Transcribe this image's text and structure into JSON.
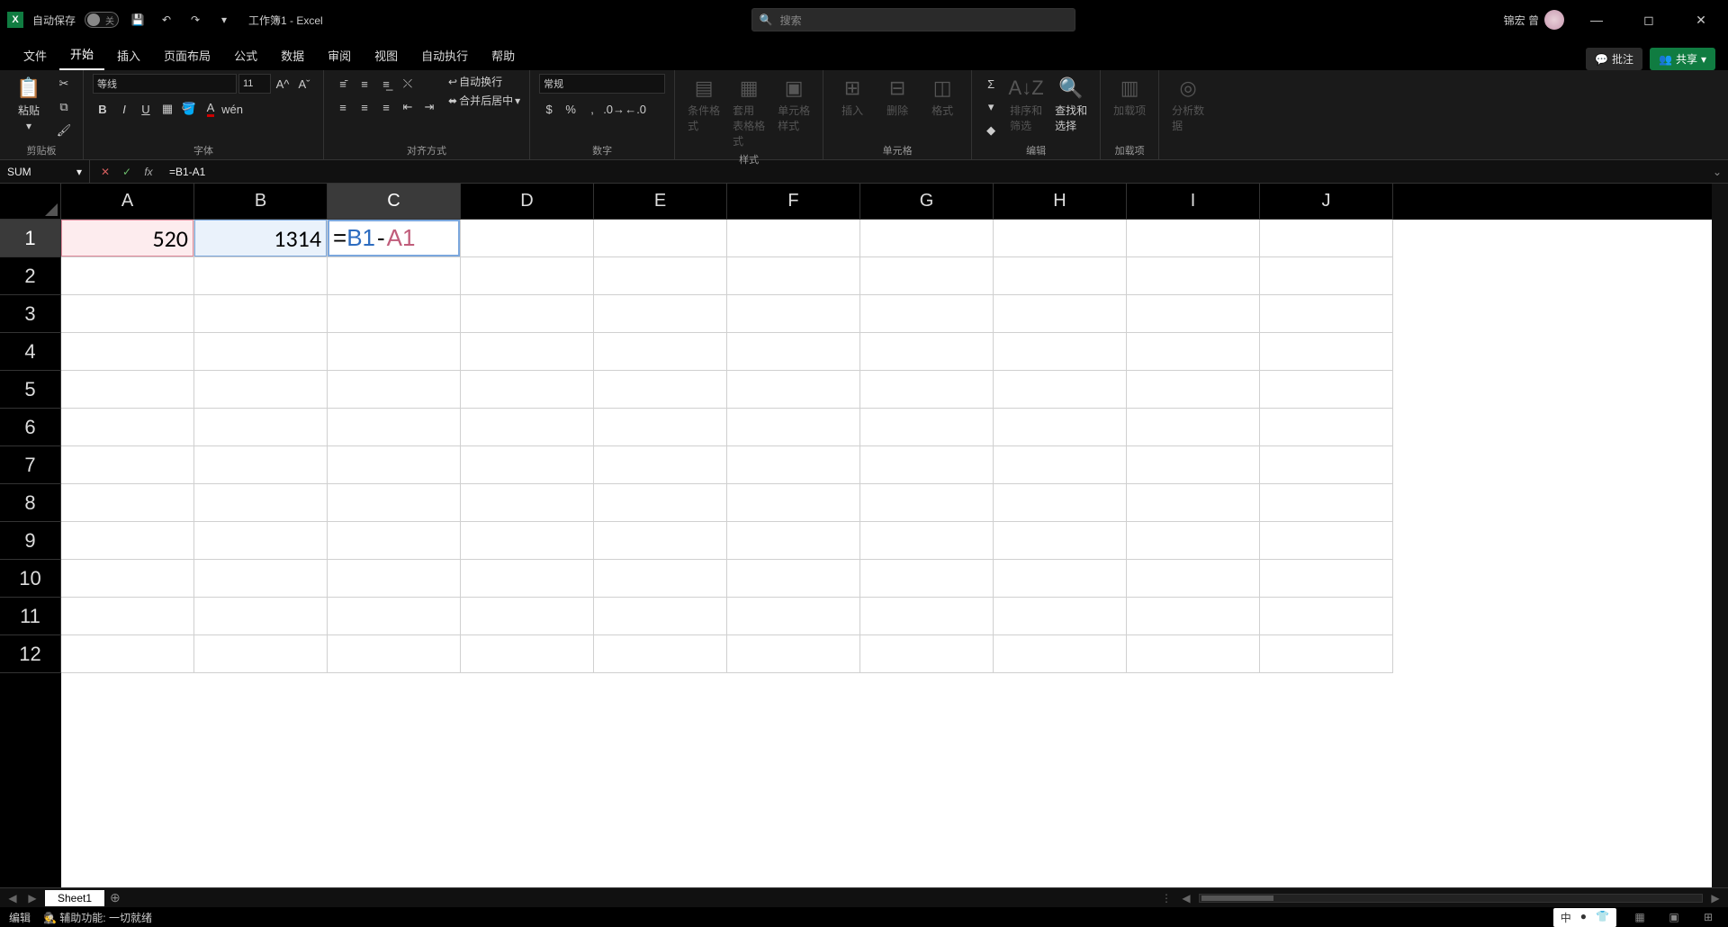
{
  "title": "工作簿1 - Excel",
  "autosave_label": "自动保存",
  "autosave_state": "关",
  "search_placeholder": "搜索",
  "user_name": "锦宏 曾",
  "menu": {
    "file": "文件",
    "home": "开始",
    "insert": "插入",
    "layout": "页面布局",
    "formulas": "公式",
    "data": "数据",
    "review": "审阅",
    "view": "视图",
    "automate": "自动执行",
    "help": "帮助"
  },
  "comments_btn": "批注",
  "share_btn": "共享",
  "ribbon": {
    "clipboard": {
      "paste": "粘贴",
      "label": "剪贴板"
    },
    "font": {
      "name": "等线",
      "size": "11",
      "label": "字体"
    },
    "align": {
      "wrap": "自动换行",
      "merge": "合并后居中",
      "label": "对齐方式"
    },
    "number": {
      "format": "常规",
      "label": "数字"
    },
    "styles": {
      "cond": "条件格式",
      "table": "套用\n表格格式",
      "cell": "单元格样式",
      "label": "样式"
    },
    "cells": {
      "insert": "插入",
      "delete": "删除",
      "format": "格式",
      "label": "单元格"
    },
    "editing": {
      "sort": "排序和筛选",
      "find": "查找和选择",
      "label": "编辑"
    },
    "addins": {
      "addins": "加载项",
      "label": "加载项"
    },
    "analysis": {
      "analyze": "分析数据"
    }
  },
  "namebox": "SUM",
  "formula": "=B1-A1",
  "columns": [
    "A",
    "B",
    "C",
    "D",
    "E",
    "F",
    "G",
    "H",
    "I",
    "J"
  ],
  "rows": [
    "1",
    "2",
    "3",
    "4",
    "5",
    "6",
    "7",
    "8",
    "9",
    "10",
    "11",
    "12"
  ],
  "cells": {
    "A1": "520",
    "B1": "1314"
  },
  "editing_cell": {
    "eq": "=",
    "ref1": "B1",
    "op": "-",
    "ref2": "A1"
  },
  "sheet": "Sheet1",
  "status": {
    "mode": "编辑",
    "acc": "辅助功能: 一切就绪"
  },
  "ime": {
    "a": "中",
    "b": "●",
    "c": "👕"
  }
}
